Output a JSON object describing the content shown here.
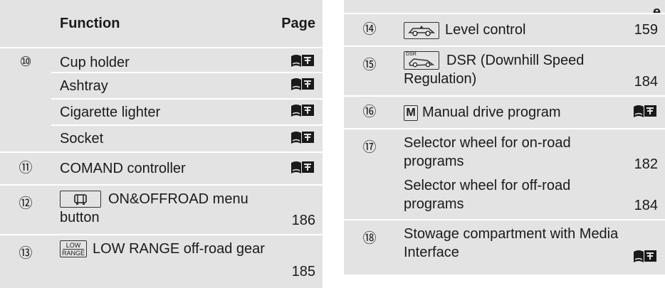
{
  "left": {
    "header": {
      "function": "Function",
      "page": "Page"
    },
    "rows": [
      {
        "num": "⑩",
        "items": [
          {
            "text": "Cup holder",
            "page": "book"
          },
          {
            "text": "Ashtray",
            "page": "book"
          },
          {
            "text": "Cigarette lighter",
            "page": "book"
          },
          {
            "text": "Socket",
            "page": "book"
          }
        ]
      },
      {
        "num": "⑪",
        "items": [
          {
            "text": "COMAND controller",
            "page": "book"
          }
        ]
      },
      {
        "num": "⑫",
        "items": [
          {
            "text": "ON&OFFROAD menu button",
            "page": "186"
          }
        ]
      },
      {
        "num": "⑬",
        "items": [
          {
            "text": "LOW RANGE off-road gear",
            "page": "185",
            "icon_top": "LOW",
            "icon_bottom": "RANGE"
          }
        ]
      }
    ]
  },
  "right": {
    "header": {
      "page_partial": "e"
    },
    "rows": [
      {
        "num": "⑭",
        "items": [
          {
            "text": "Level control",
            "page": "159"
          }
        ]
      },
      {
        "num": "⑮",
        "items": [
          {
            "text": "DSR (Downhill Speed Regulation)",
            "page": "184",
            "icon_label": "DSR"
          }
        ]
      },
      {
        "num": "⑯",
        "items": [
          {
            "text": "Manual drive program",
            "page": "book",
            "icon_letter": "M"
          }
        ]
      },
      {
        "num": "⑰",
        "items": [
          {
            "text": "Selector wheel for on-road programs",
            "page": "182"
          },
          {
            "text": "Selector wheel for off-road programs",
            "page": "184"
          }
        ]
      },
      {
        "num": "⑱",
        "items": [
          {
            "text": "Stowage compartment with Media Interface",
            "page": "book"
          }
        ]
      }
    ]
  },
  "colors": {
    "cell_bg": "#e3e3e3",
    "text": "#1a1a1a"
  },
  "icons": [
    "book-icon",
    "car-menu-icon",
    "low-range-icon",
    "level-control-icon",
    "dsr-icon",
    "manual-m-icon"
  ]
}
